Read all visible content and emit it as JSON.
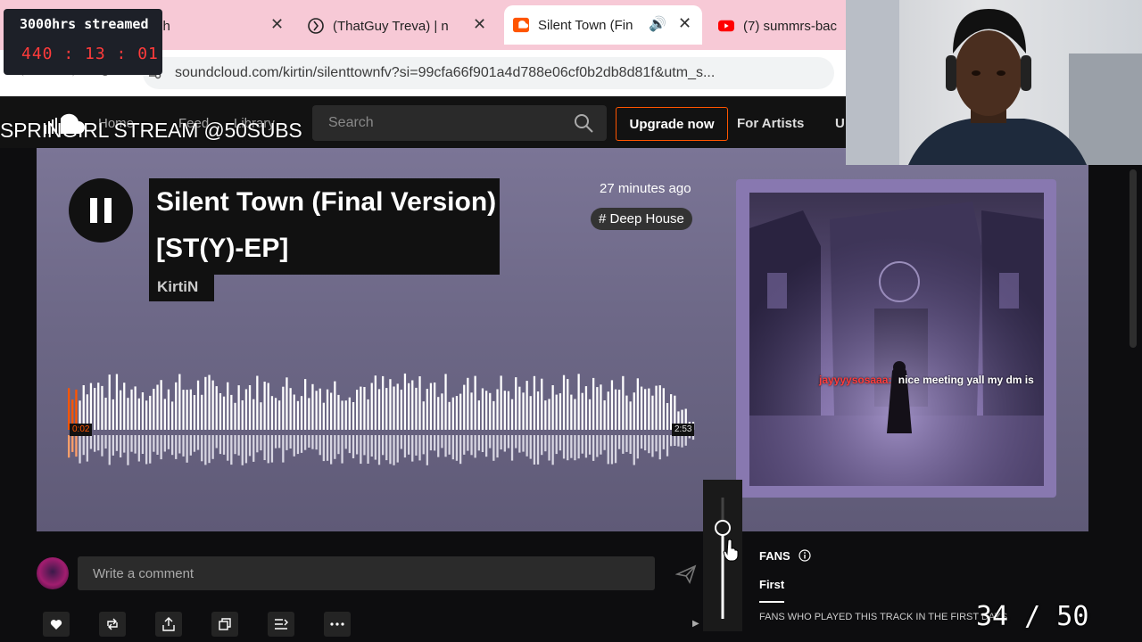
{
  "browser": {
    "tabs": [
      {
        "label": "ch",
        "icon": "tab-icon"
      },
      {
        "label": "(ThatGuy Treva) | n",
        "icon": "kick-icon"
      },
      {
        "label": "Silent Town (Fin",
        "icon": "soundcloud-icon",
        "active": true
      },
      {
        "label": "(7) summrs-bac",
        "icon": "youtube-icon"
      }
    ],
    "url": "soundcloud.com/kirtin/silenttownfv?si=99cfa66f901a4d788e06cf0b2db8d81f&utm_s..."
  },
  "overlay": {
    "timer_label": "3000hrs streamed",
    "timer_value": "440 : 13 : 01",
    "stream_title": "SPRINGIRL STREAM @50SUBS",
    "sub_counter": "34 / 50"
  },
  "header": {
    "nav": [
      "Home",
      "Feed",
      "Library"
    ],
    "search_placeholder": "Search",
    "upgrade_label": "Upgrade now",
    "for_artists_label": "For Artists",
    "trailing_label": "U"
  },
  "track": {
    "title_line1": "Silent Town (Final Version)",
    "title_line2": "[ST(Y)-EP]",
    "artist": "KirtiN",
    "posted": "27 minutes ago",
    "tag": "# Deep House",
    "elapsed": "0:02",
    "duration": "2:53",
    "progress": 0.012
  },
  "chat": {
    "user": "jayyyysosaaa:",
    "message": "nice meeting yall my dm is",
    "user_color": "#ff3b3b"
  },
  "comment": {
    "placeholder": "Write a comment"
  },
  "fans": {
    "title": "FANS",
    "tab_first": "First",
    "description": "FANS WHO PLAYED THIS TRACK IN THE FIRST DAYS"
  },
  "volume": {
    "level": 0.75
  },
  "colors": {
    "accent": "#ff5500",
    "hero_bg": "#6d6887",
    "timer_red": "#ff3b3b"
  }
}
